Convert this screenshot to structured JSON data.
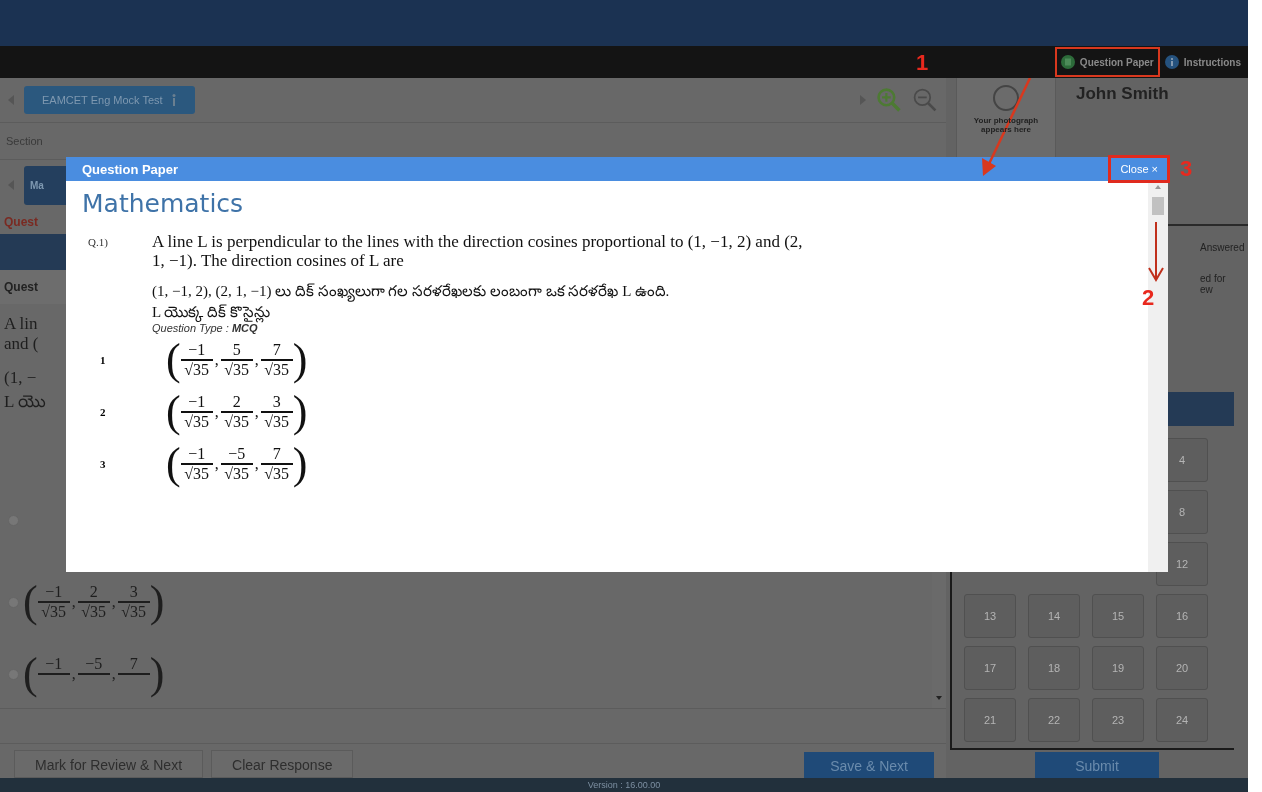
{
  "header": {
    "question_paper_link": "Question Paper",
    "instructions_link": "Instructions"
  },
  "toolbar": {
    "test_tab": "EAMCET Eng Mock Test"
  },
  "section_label": "Section",
  "section_tab": "Ma",
  "question_bar_label": "Quest",
  "question_heading": "Quest",
  "question_fragments": [
    "A lin",
    "and (",
    "(1, −",
    "L యొ"
  ],
  "options": [
    {
      "selected": false
    },
    {
      "selected": false,
      "open": "(",
      "close": ")",
      "terms": [
        {
          "num": "−1",
          "den": "√35",
          "sep": ","
        },
        {
          "num": "2",
          "den": "√35",
          "sep": ","
        },
        {
          "num": "3",
          "den": "√35"
        }
      ]
    },
    {
      "selected": false,
      "open": "(",
      "close": ")",
      "terms": [
        {
          "num": "−1",
          "sep": ","
        },
        {
          "num": "−5",
          "sep": ","
        },
        {
          "num": "7"
        }
      ]
    }
  ],
  "profile": {
    "photo_caption": "Your photograph appears here",
    "name": "John Smith"
  },
  "legend": [
    "Answered",
    "ed for\new"
  ],
  "palette": [
    "4",
    "8",
    "12",
    "13",
    "14",
    "15",
    "16",
    "17",
    "18",
    "19",
    "20",
    "21",
    "22",
    "23",
    "24"
  ],
  "buttons": {
    "mark_review": "Mark for Review & Next",
    "clear": "Clear Response",
    "save_next": "Save & Next",
    "submit": "Submit"
  },
  "footer": {
    "version": "Version : 16.00.00"
  },
  "modal": {
    "title": "Question Paper",
    "close": "Close ×",
    "subject": "Mathematics",
    "question": {
      "number": "Q.1)",
      "text": "A line L is perpendicular to the lines with the direction cosines proportional to (1, −1, 2) and (2, 1, −1). The direction cosines of L are",
      "text_te": "(1, −1, 2), (2, 1, −1) లు దిక్ సంఖ్యలుగా గల సరళరేఖలకు లంబంగా ఒక సరళరేఖ L ఉంది.",
      "text_te2": "L యొక్క దిక్ కొసైన్లు",
      "type": "Question Type : **MCQ**"
    },
    "options": [
      {
        "number": "1",
        "open": "(",
        "close": ")",
        "terms": [
          {
            "num": "−1",
            "den": "√35",
            "sep": ","
          },
          {
            "num": "5",
            "den": "√35",
            "sep": ","
          },
          {
            "num": "7",
            "den": "√35"
          }
        ]
      },
      {
        "number": "2",
        "open": "(",
        "close": ")",
        "terms": [
          {
            "num": "−1",
            "den": "√35",
            "sep": ","
          },
          {
            "num": "2",
            "den": "√35",
            "sep": ","
          },
          {
            "num": "3",
            "den": "√35"
          }
        ]
      },
      {
        "number": "3",
        "open": "(",
        "close": ")",
        "terms": [
          {
            "num": "−1",
            "den": "√35",
            "sep": ","
          },
          {
            "num": "−5",
            "den": "√35",
            "sep": ","
          },
          {
            "num": "7",
            "den": "√35"
          }
        ]
      }
    ]
  },
  "annotations": [
    {
      "number": "1"
    },
    {
      "number": "2"
    },
    {
      "number": "3"
    }
  ]
}
